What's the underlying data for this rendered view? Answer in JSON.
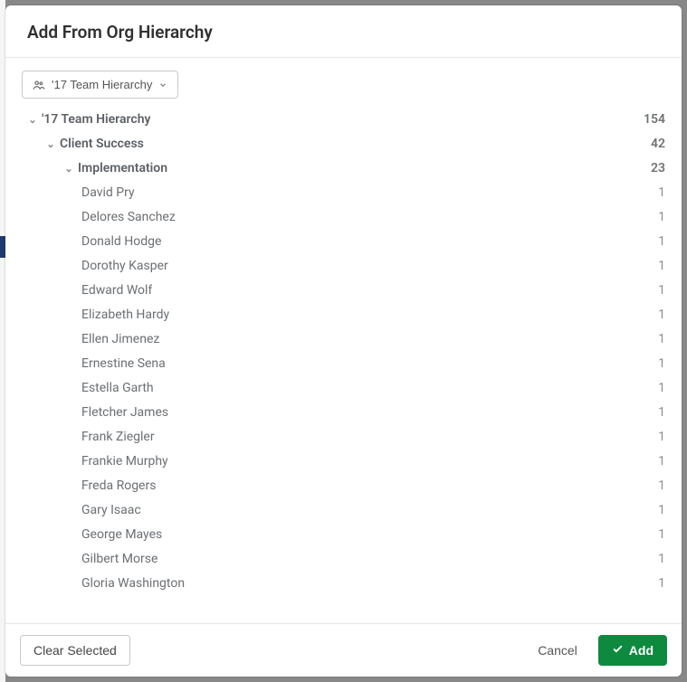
{
  "modal": {
    "title": "Add From Org Hierarchy",
    "dropdown_label": "'17 Team Hierarchy"
  },
  "tree": {
    "root": {
      "label": "'17 Team Hierarchy",
      "count": "154"
    },
    "l1": {
      "label": "Client Success",
      "count": "42"
    },
    "l2": {
      "label": "Implementation",
      "count": "23"
    },
    "people": [
      {
        "name": "David Pry",
        "count": "1"
      },
      {
        "name": "Delores Sanchez",
        "count": "1"
      },
      {
        "name": "Donald Hodge",
        "count": "1"
      },
      {
        "name": "Dorothy Kasper",
        "count": "1"
      },
      {
        "name": "Edward Wolf",
        "count": "1"
      },
      {
        "name": "Elizabeth Hardy",
        "count": "1"
      },
      {
        "name": "Ellen Jimenez",
        "count": "1"
      },
      {
        "name": "Ernestine Sena",
        "count": "1"
      },
      {
        "name": "Estella Garth",
        "count": "1"
      },
      {
        "name": "Fletcher James",
        "count": "1"
      },
      {
        "name": "Frank Ziegler",
        "count": "1"
      },
      {
        "name": "Frankie Murphy",
        "count": "1"
      },
      {
        "name": "Freda Rogers",
        "count": "1"
      },
      {
        "name": "Gary Isaac",
        "count": "1"
      },
      {
        "name": "George Mayes",
        "count": "1"
      },
      {
        "name": "Gilbert Morse",
        "count": "1"
      },
      {
        "name": "Gloria Washington",
        "count": "1"
      }
    ]
  },
  "footer": {
    "clear": "Clear Selected",
    "cancel": "Cancel",
    "add": "Add"
  }
}
